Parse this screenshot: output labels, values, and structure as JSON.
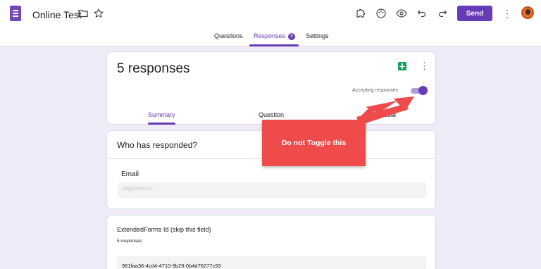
{
  "header": {
    "title": "Online Test",
    "send_label": "Send",
    "icons": [
      "folder-icon",
      "star-icon",
      "addons-icon",
      "palette-icon",
      "eye-icon",
      "undo-icon",
      "redo-icon",
      "more-icon"
    ]
  },
  "tabs": {
    "questions": "Questions",
    "responses": "Responses",
    "responses_badge": "5",
    "settings": "Settings",
    "active": "Responses"
  },
  "summary_card": {
    "count_text": "5 responses",
    "accepting_label": "Accepting responses",
    "accepting_on": true,
    "subtabs": [
      "Summary",
      "Question",
      "Individual"
    ],
    "active_subtab": "Summary"
  },
  "who_responded": {
    "title": "Who has responded?",
    "email_label": "Email",
    "email_value": "••••@••••••••••.••"
  },
  "question_card": {
    "title": "ExtendedForms Id (skip this field)",
    "subtitle": "5 responses",
    "answer": "961faa36-4cd4-4710-9b29-0b4d76277c93"
  },
  "annotation": {
    "text": "Do not Toggle this"
  },
  "colors": {
    "accent": "#673ab7",
    "background": "#f0ebf8",
    "callout": "#ef4b4b"
  }
}
